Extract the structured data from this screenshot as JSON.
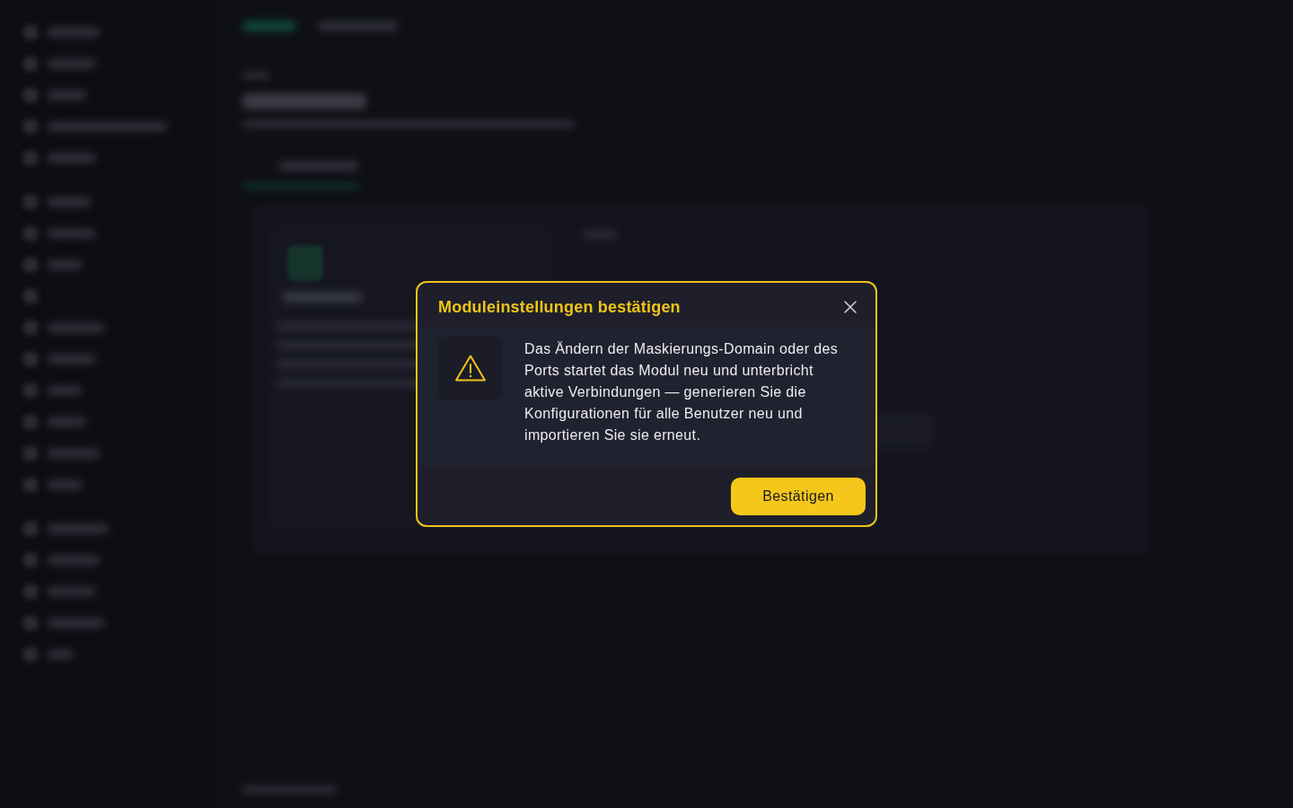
{
  "dialog": {
    "title": "Moduleinstellungen bestätigen",
    "message": "Das Ändern der Maskierungs-Domain oder des Ports startet das Modul neu und unterbricht aktive Verbindungen — generieren Sie die Konfigurationen für alle Benutzer neu und importieren Sie sie erneut.",
    "buttons": [
      {
        "label": "Bestätigen",
        "kind": "primary"
      }
    ]
  }
}
